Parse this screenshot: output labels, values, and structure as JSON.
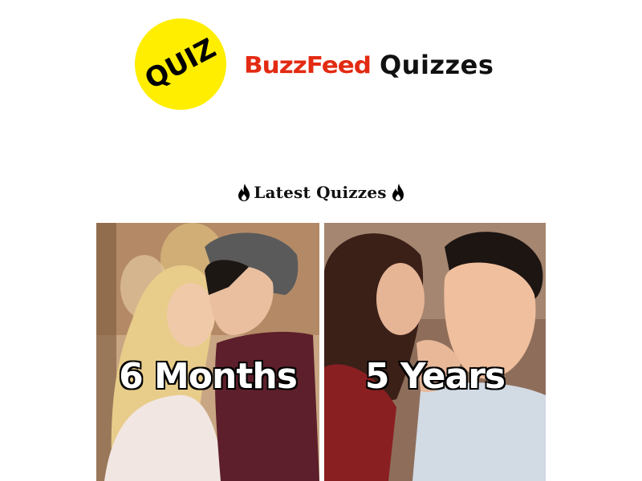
{
  "header": {
    "quiz_badge": "QUIZ",
    "brand_name": "BuzzFeed",
    "brand_suffix": "Quizzes"
  },
  "section": {
    "title": "Latest Quizzes",
    "icon": "flame-icon"
  },
  "quizzes": [
    {
      "label": "6 Months"
    },
    {
      "label": "5 Years"
    }
  ],
  "colors": {
    "brand_red": "#e32a12",
    "badge_yellow": "#ffee00"
  }
}
